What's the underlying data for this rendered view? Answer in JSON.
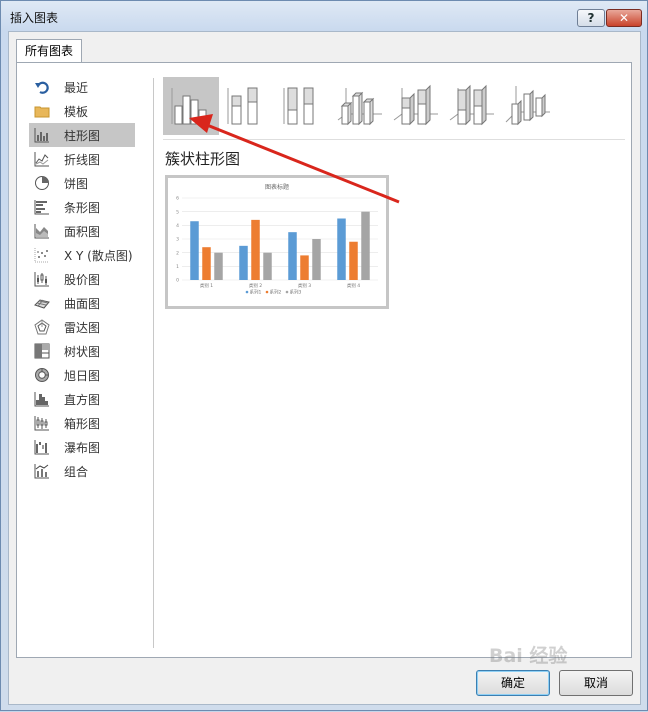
{
  "window": {
    "title": "插入图表",
    "help_label": "?",
    "close_label": "✕"
  },
  "tabs": [
    {
      "label": "所有图表"
    }
  ],
  "sidebar": {
    "items": [
      {
        "label": "最近",
        "icon": "undo-arrow-icon"
      },
      {
        "label": "模板",
        "icon": "folder-icon"
      },
      {
        "label": "柱形图",
        "icon": "column-chart-icon",
        "selected": true
      },
      {
        "label": "折线图",
        "icon": "line-chart-icon"
      },
      {
        "label": "饼图",
        "icon": "pie-chart-icon"
      },
      {
        "label": "条形图",
        "icon": "bar-chart-icon"
      },
      {
        "label": "面积图",
        "icon": "area-chart-icon"
      },
      {
        "label": "X Y (散点图)",
        "icon": "scatter-chart-icon"
      },
      {
        "label": "股价图",
        "icon": "stock-chart-icon"
      },
      {
        "label": "曲面图",
        "icon": "surface-chart-icon"
      },
      {
        "label": "雷达图",
        "icon": "radar-chart-icon"
      },
      {
        "label": "树状图",
        "icon": "treemap-chart-icon"
      },
      {
        "label": "旭日图",
        "icon": "sunburst-chart-icon"
      },
      {
        "label": "直方图",
        "icon": "histogram-chart-icon"
      },
      {
        "label": "箱形图",
        "icon": "box-whisker-chart-icon"
      },
      {
        "label": "瀑布图",
        "icon": "waterfall-chart-icon"
      },
      {
        "label": "组合",
        "icon": "combo-chart-icon"
      }
    ]
  },
  "subtypes": [
    {
      "name": "clustered-column",
      "selected": true
    },
    {
      "name": "stacked-column"
    },
    {
      "name": "100-stacked-column"
    },
    {
      "name": "3d-clustered-column"
    },
    {
      "name": "3d-stacked-column"
    },
    {
      "name": "3d-100-stacked-column"
    },
    {
      "name": "3d-column"
    }
  ],
  "selected_chart_name": "簇状柱形图",
  "preview": {
    "chart_data": {
      "type": "bar",
      "title": "图表标题",
      "categories": [
        "类别 1",
        "类别 2",
        "类别 3",
        "类别 4"
      ],
      "series": [
        {
          "name": "系列1",
          "values": [
            4.3,
            2.5,
            3.5,
            4.5
          ],
          "color": "#5b9bd5"
        },
        {
          "name": "系列2",
          "values": [
            2.4,
            4.4,
            1.8,
            2.8
          ],
          "color": "#ed7d31"
        },
        {
          "name": "系列3",
          "values": [
            2.0,
            2.0,
            3.0,
            5.0
          ],
          "color": "#a5a5a5"
        }
      ],
      "ylim": [
        0,
        6
      ],
      "yticks": [
        0,
        1,
        2,
        3,
        4,
        5,
        6
      ],
      "grid": true,
      "legend": "bottom"
    }
  },
  "buttons": {
    "ok": "确定",
    "cancel": "取消"
  },
  "watermark": "Bai 经验",
  "colors": {
    "selection": "#c6c6c6",
    "annotation_arrow": "#d9261c"
  }
}
